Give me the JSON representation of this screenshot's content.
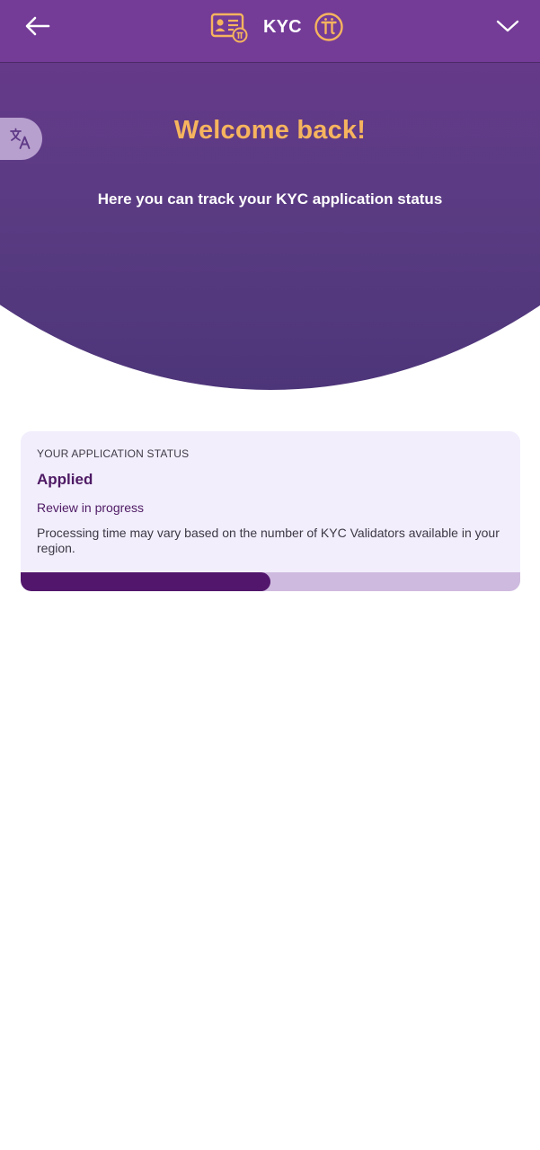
{
  "header": {
    "title": "KYC",
    "back_icon": "arrow-left-icon",
    "card_icon": "id-card-pi-icon",
    "brand_icon": "pi-coin-icon",
    "menu_icon": "chevron-down-icon"
  },
  "language_button": {
    "icon": "translate-icon"
  },
  "hero": {
    "title": "Welcome back!",
    "subtitle": "Here you can track your KYC application status"
  },
  "status_card": {
    "label": "YOUR APPLICATION STATUS",
    "status": "Applied",
    "substatus": "Review in progress",
    "note": "Processing time may vary based on the number of KYC Validators available in your region.",
    "progress_fraction": 0.5
  },
  "colors": {
    "header_bg": "#743b97",
    "accent_orange": "#f6b45e",
    "deep_purple": "#52176c",
    "card_bg": "#f2eefc",
    "progress_track": "#cfbadf"
  }
}
